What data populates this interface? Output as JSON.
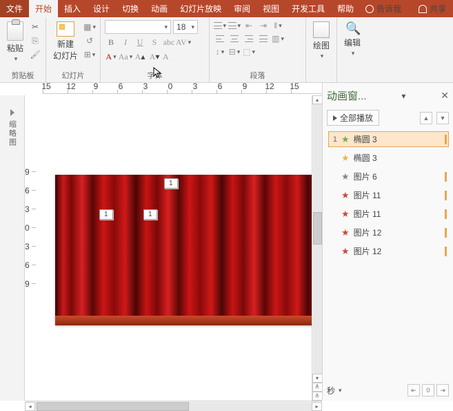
{
  "tabs": {
    "file": "文件",
    "home": "开始",
    "insert": "插入",
    "design": "设计",
    "transitions": "切换",
    "animations": "动画",
    "slideshow": "幻灯片放映",
    "review": "审阅",
    "view": "视图",
    "developer": "开发工具",
    "help": "帮助",
    "tellme": "告诉我",
    "share": "共享"
  },
  "ribbon": {
    "clipboard": {
      "label": "剪贴板",
      "paste": "粘贴"
    },
    "slides": {
      "label": "幻灯片",
      "newslide": "新建\n幻灯片"
    },
    "font": {
      "label": "字体",
      "size": "18",
      "bold": "B",
      "italic": "I",
      "underline": "U",
      "strike": "S"
    },
    "paragraph": {
      "label": "段落"
    },
    "drawing": {
      "label": "绘图"
    },
    "editing": {
      "label": "编辑"
    }
  },
  "ruler": {
    "h": [
      "15",
      "12",
      "9",
      "6",
      "3",
      "0",
      "3",
      "6",
      "9",
      "12",
      "15"
    ],
    "v": [
      "9",
      "6",
      "3",
      "0",
      "3",
      "6",
      "9"
    ]
  },
  "slide_tags": {
    "a": "1",
    "b": "1",
    "c": "1"
  },
  "pane": {
    "title": "动画窗...",
    "play_all": "全部播放",
    "items": [
      {
        "num": "1",
        "star": "green",
        "label": "椭圆 3",
        "sel": true
      },
      {
        "num": "",
        "star": "yellow",
        "label": "椭圆 3"
      },
      {
        "num": "",
        "star": "grey",
        "label": "图片 6"
      },
      {
        "num": "",
        "star": "red",
        "label": "图片 11"
      },
      {
        "num": "",
        "star": "red",
        "label": "图片 11"
      },
      {
        "num": "",
        "star": "red",
        "label": "图片 12"
      },
      {
        "num": "",
        "star": "red",
        "label": "图片 12"
      }
    ],
    "seconds": "秒"
  }
}
